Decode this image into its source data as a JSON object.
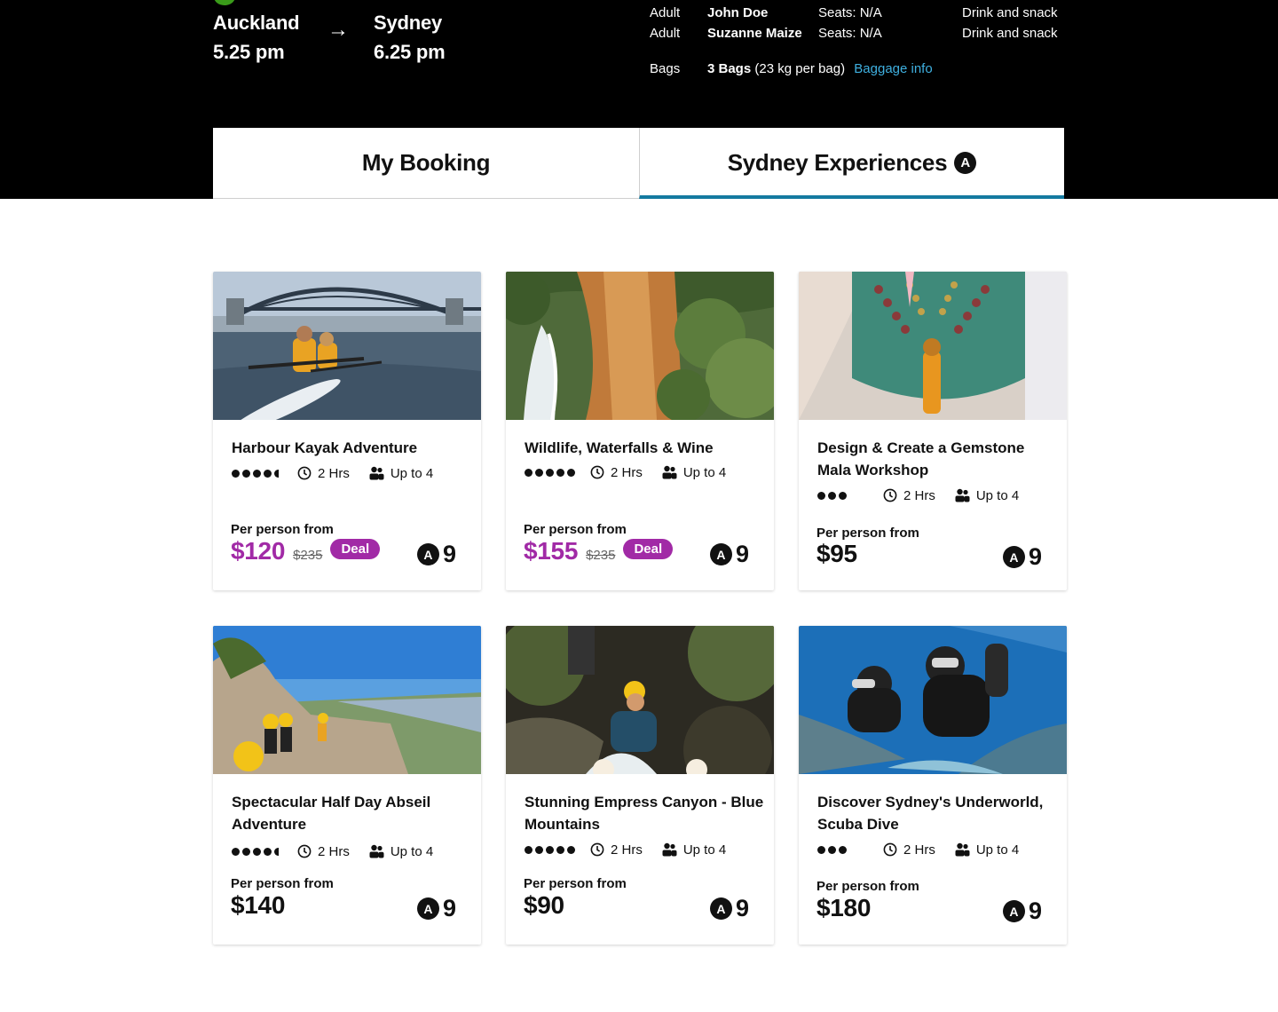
{
  "flight": {
    "from_city": "Auckland",
    "from_time": "5.25 pm",
    "to_city": "Sydney",
    "to_time": "6.25 pm",
    "arrow": "→",
    "passengers": [
      {
        "type": "Adult",
        "name": "John Doe",
        "seats": "Seats: N/A",
        "meal": "Drink and snack"
      },
      {
        "type": "Adult",
        "name": "Suzanne Maize",
        "seats": "Seats: N/A",
        "meal": "Drink and snack"
      }
    ],
    "bags_label": "Bags",
    "bags_count": "3 Bags",
    "bags_detail": "(23 kg per bag)",
    "baggage_link": "Baggage info"
  },
  "tabs": [
    {
      "label": "My Booking",
      "active": false
    },
    {
      "label": "Sydney Experiences",
      "active": true,
      "icon": "airpoints-icon",
      "icon_glyph": "A"
    }
  ],
  "experiences": [
    {
      "title": "Harbour Kayak Adventure",
      "rating": 4.5,
      "duration": "2 Hrs",
      "group": "Up to 4",
      "per_person_label": "Per person from",
      "price": "$120",
      "old_price": "$235",
      "deal": "Deal",
      "points_glyph": "A",
      "points": "9"
    },
    {
      "title": "Wildlife, Waterfalls & Wine",
      "rating": 5,
      "duration": "2 Hrs",
      "group": "Up to 4",
      "per_person_label": "Per person from",
      "price": "$155",
      "old_price": "$235",
      "deal": "Deal",
      "points_glyph": "A",
      "points": "9"
    },
    {
      "title": "Design & Create a Gemstone Mala Workshop",
      "rating": 3,
      "duration": "2 Hrs",
      "group": "Up to 4",
      "per_person_label": "Per person from",
      "price": "$95",
      "points_glyph": "A",
      "points": "9"
    },
    {
      "title": "Spectacular Half Day Abseil Adventure",
      "rating": 4.5,
      "duration": "2 Hrs",
      "group": "Up to 4",
      "per_person_label": "Per person from",
      "price": "$140",
      "points_glyph": "A",
      "points": "9"
    },
    {
      "title": "Stunning Empress Canyon - Blue Mountains",
      "rating": 5,
      "duration": "2 Hrs",
      "group": "Up to 4",
      "per_person_label": "Per person from",
      "price": "$90",
      "points_glyph": "A",
      "points": "9"
    },
    {
      "title": "Discover Sydney's Underworld, Scuba Dive",
      "rating": 3,
      "duration": "2 Hrs",
      "group": "Up to 4",
      "per_person_label": "Per person from",
      "price": "$180",
      "points_glyph": "A",
      "points": "9"
    }
  ],
  "colors": {
    "header_bg": "#000000",
    "deal_accent": "#a12aa6",
    "tab_active_underline": "#147aa0",
    "link": "#3fb0e0"
  }
}
